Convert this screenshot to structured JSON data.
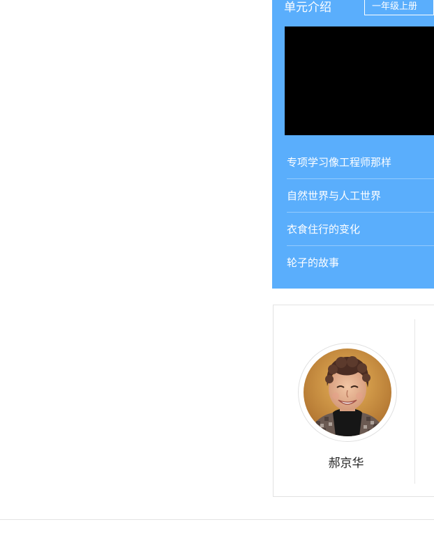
{
  "unit_panel": {
    "title": "单元介绍",
    "grade_selected": "一年级上册",
    "items": [
      {
        "label": "专项学习像工程师那样"
      },
      {
        "label": "自然世界与人工世界"
      },
      {
        "label": "衣食住行的变化"
      },
      {
        "label": "轮子的故事"
      }
    ]
  },
  "teacher": {
    "name": "郝京华"
  },
  "colors": {
    "panel_blue": "#5aaefc",
    "video_bg": "#000000"
  }
}
